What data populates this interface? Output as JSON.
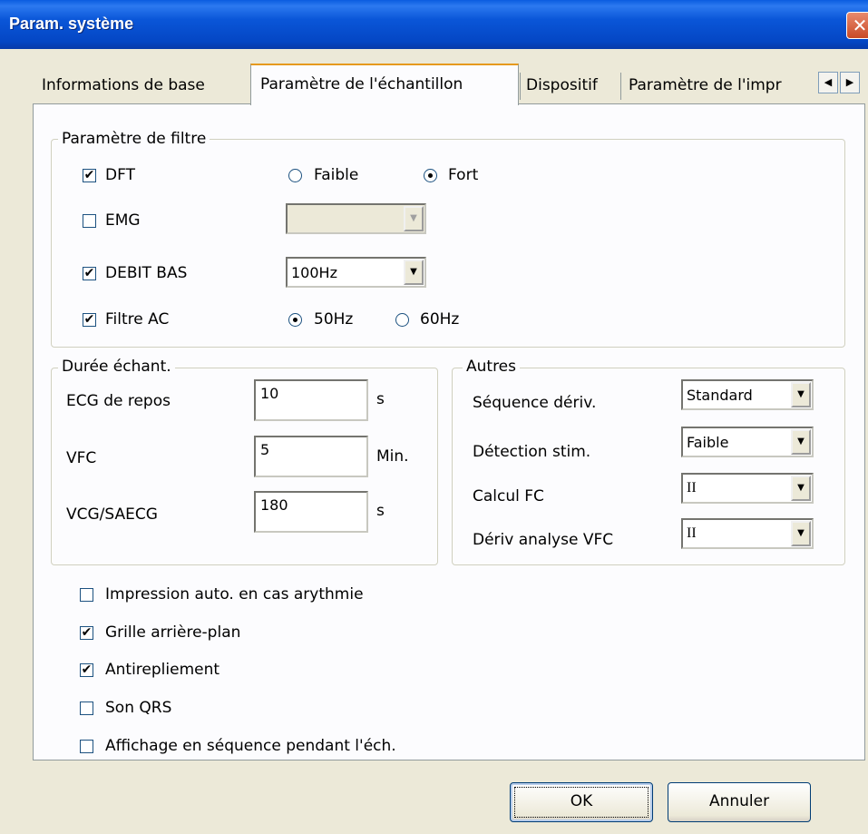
{
  "window": {
    "title": "Param. système",
    "close_icon": "close-icon"
  },
  "tabs": [
    {
      "label": "Informations de base"
    },
    {
      "label": "Paramètre de l'échantillon"
    },
    {
      "label": "Dispositif"
    },
    {
      "label": "Paramètre de l'impr"
    }
  ],
  "tab_scroll": {
    "left": "◀",
    "right": "▶"
  },
  "filter_group": {
    "legend": "Paramètre de filtre",
    "dft": {
      "label": "DFT",
      "checked": true,
      "opt_low": "Faible",
      "opt_high": "Fort",
      "selected": "Fort"
    },
    "emg": {
      "label": "EMG",
      "checked": false,
      "value": ""
    },
    "low_rate": {
      "label": "DEBIT BAS",
      "checked": true,
      "value": "100Hz"
    },
    "ac": {
      "label": "Filtre AC",
      "checked": true,
      "opt_50": "50Hz",
      "opt_60": "60Hz",
      "selected": "50Hz"
    }
  },
  "duration_group": {
    "legend": "Durée échant.",
    "rest": {
      "label": "ECG de repos",
      "value": "10",
      "unit": "s"
    },
    "hrv": {
      "label": "VFC",
      "value": "5",
      "unit": "Min."
    },
    "vcg": {
      "label": "VCG/SAECG",
      "value": "180",
      "unit": "s"
    }
  },
  "other_group": {
    "legend": "Autres",
    "lead_seq": {
      "label": "Séquence dériv.",
      "value": "Standard"
    },
    "pace": {
      "label": "Détection stim.",
      "value": "Faible"
    },
    "hr_calc": {
      "label": "Calcul FC",
      "value": "II"
    },
    "hrv_lead": {
      "label": "Dériv analyse VFC",
      "value": "II"
    }
  },
  "options": [
    {
      "label": "Impression auto. en cas arythmie",
      "checked": false
    },
    {
      "label": "Grille arrière-plan",
      "checked": true
    },
    {
      "label": "Antirepliement",
      "checked": true
    },
    {
      "label": "Son QRS",
      "checked": false
    },
    {
      "label": "Affichage en séquence pendant l'éch.",
      "checked": false
    }
  ],
  "buttons": {
    "ok": "OK",
    "cancel": "Annuler"
  },
  "glyphs": {
    "check": "✔",
    "dropdown": "▼"
  }
}
